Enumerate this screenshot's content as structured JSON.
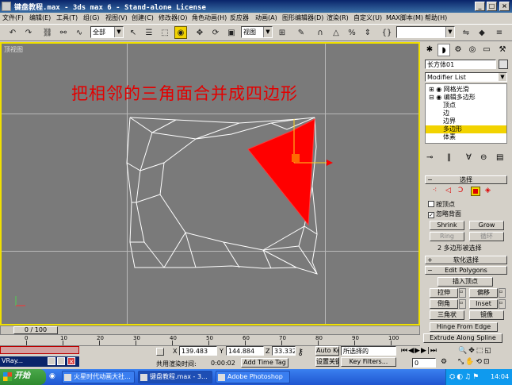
{
  "window": {
    "title": "键盘教程.max - 3ds max 6 - Stand-alone License",
    "buttons": [
      "_",
      "□",
      "×"
    ]
  },
  "menu": [
    "文件(F)",
    "编辑(E)",
    "工具(T)",
    "组(G)",
    "视图(V)",
    "创建(C)",
    "修改器(O)",
    "角色动画(H)",
    "反应器",
    "动画(A)",
    "图形编辑器(D)",
    "渲染(R)",
    "自定义(U)",
    "MAX脚本(M)",
    "帮助(H)"
  ],
  "toolbar": {
    "selection_filter": "全部",
    "ref_coord": "视图",
    "named_selection": ""
  },
  "viewport": {
    "label": "顶视图",
    "caption": "把相邻的三角面合并成四边形",
    "colors": {
      "background": "#7a7a7a",
      "grid": "#b9b9b9",
      "wire": "#ffffff",
      "selection": "#ff0000"
    }
  },
  "panel": {
    "object_name": "长方体01",
    "modifier_list": "Modifier List",
    "stack": [
      {
        "label": "网格光滑"
      },
      {
        "label": "编辑多边形"
      },
      {
        "label": "顶点"
      },
      {
        "label": "边"
      },
      {
        "label": "边界"
      },
      {
        "label": "多边形",
        "highlighted": true
      },
      {
        "label": "体素"
      }
    ],
    "selection_rollout": "选择",
    "by_vertex": "按顶点",
    "ignore_backfacing": "忽略背面",
    "shrink": "Shrink",
    "grow": "Grow",
    "ring": "Ring",
    "loop": "循环",
    "selection_status": "2 多边形被选择",
    "soft_selection_rollout": "软化选择",
    "edit_polygons_rollout": "Edit Polygons",
    "insert_vertex": "插入顶点",
    "extrude": "拉伸",
    "outline": "偏移",
    "bevel": "倒角",
    "inset": "Inset",
    "triangle": "三角状",
    "mirror": "镜像",
    "hinge_from_edge": "Hinge From Edge",
    "extrude_along_spline": "Extrude Along Spline"
  },
  "time": {
    "slider": "0 / 100",
    "ticks": [
      "0",
      "10",
      "20",
      "30",
      "40",
      "50",
      "60",
      "70",
      "80",
      "90",
      "100"
    ]
  },
  "status": {
    "maxscript": "",
    "vray": "VRay...",
    "x_label": "X",
    "x": "139.483",
    "y_label": "Y",
    "y": "144.884",
    "z_label": "Z",
    "z": "33.332",
    "auto_key": "Auto Key",
    "selected": "所选择的",
    "set_key": "设置关键帧",
    "key_filters": "Key Filters...",
    "render_time_label": "共用渲染时间:",
    "render_time": "0:00:02",
    "add_time_tag": "Add Time Tag",
    "frame": "0"
  },
  "taskbar": {
    "start": "开始",
    "tasks": [
      "火星时代动画大社...",
      "键盘教程.max - 3...",
      "Adobe Photoshop"
    ],
    "clock": "14:04"
  }
}
